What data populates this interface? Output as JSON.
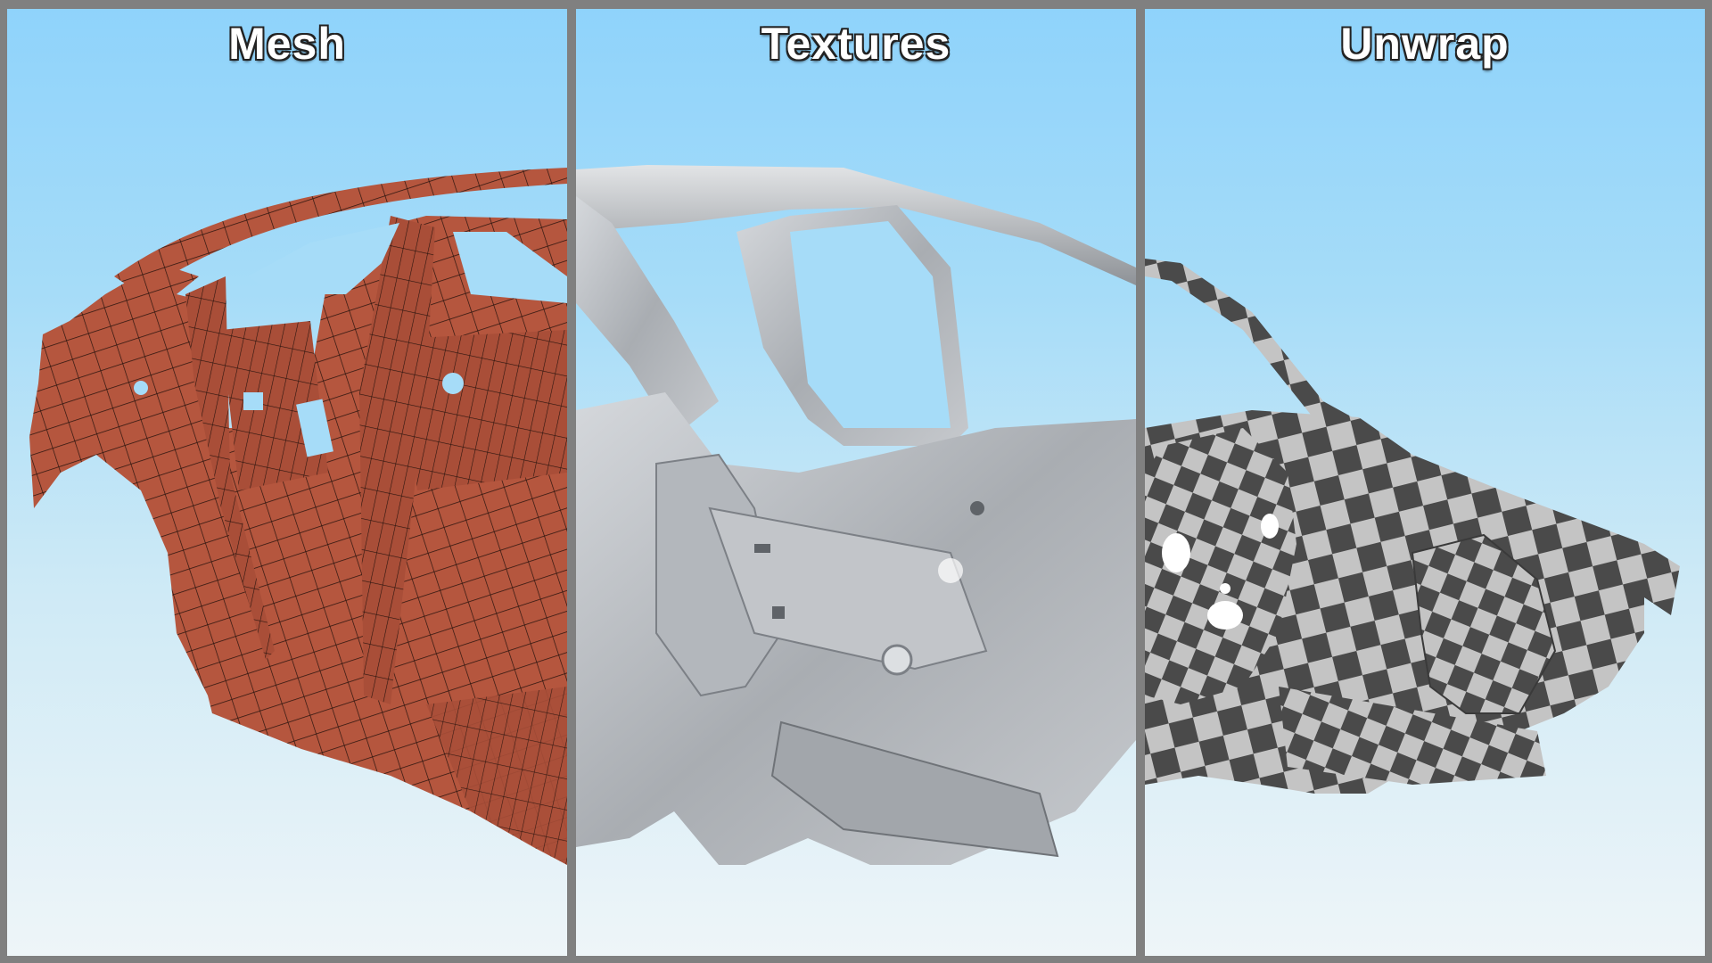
{
  "panels": [
    {
      "id": "mesh",
      "title": "Mesh",
      "material_color": "#b5563e",
      "wire_color": "#2a140e"
    },
    {
      "id": "textures",
      "title": "Textures",
      "material_color": "#b9bcc0"
    },
    {
      "id": "unwrap",
      "title": "Unwrap",
      "checker_dark": "#4a4a4a",
      "checker_light": "#c4c4c4"
    }
  ],
  "colors": {
    "divider": "#808080",
    "sky_top": "#8fd3fb",
    "sky_bottom": "#eef5f8"
  }
}
